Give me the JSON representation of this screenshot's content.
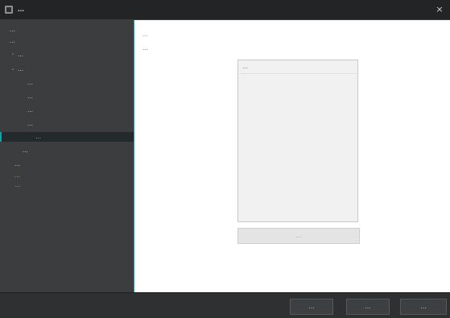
{
  "window": {
    "title": "…",
    "close_glyph": "×",
    "icon": "app-icon"
  },
  "sidebar": {
    "items": [
      {
        "label": "…",
        "indent": 1,
        "chevron": "",
        "state": ""
      },
      {
        "label": "…",
        "indent": 1,
        "chevron": "",
        "state": ""
      },
      {
        "label": "…",
        "indent": 1,
        "chevron": "›",
        "state": ""
      },
      {
        "label": "…",
        "indent": 1,
        "chevron": "⌄",
        "state": ""
      },
      {
        "label": "…",
        "indent": 3,
        "chevron": "",
        "state": ""
      },
      {
        "label": "…",
        "indent": 3,
        "chevron": "",
        "state": ""
      },
      {
        "label": "…",
        "indent": 3,
        "chevron": "",
        "state": ""
      },
      {
        "label": "…",
        "indent": 3,
        "chevron": "",
        "state": ""
      },
      {
        "label": "…",
        "indent": 3,
        "chevron": "",
        "state": "selected"
      },
      {
        "label": "…",
        "indent": 2,
        "chevron": "",
        "state": ""
      },
      {
        "label": "…",
        "indent": 1,
        "chevron": "",
        "state": ""
      },
      {
        "label": "…",
        "indent": 1,
        "chevron": "",
        "state": "accent"
      },
      {
        "label": "…",
        "indent": 1,
        "chevron": "",
        "state": "link"
      }
    ]
  },
  "main": {
    "heading": "…",
    "subtext": "…",
    "list": {
      "rows": [
        "…"
      ]
    },
    "action_button": "…"
  },
  "footer": {
    "back_label": "…",
    "next_label": "…",
    "cancel_label": "…"
  },
  "colors": {
    "accent": "#0aa0ad",
    "selection_text": "#7fd0d8",
    "warning": "#e8a33a",
    "link": "#6cb6e6"
  }
}
